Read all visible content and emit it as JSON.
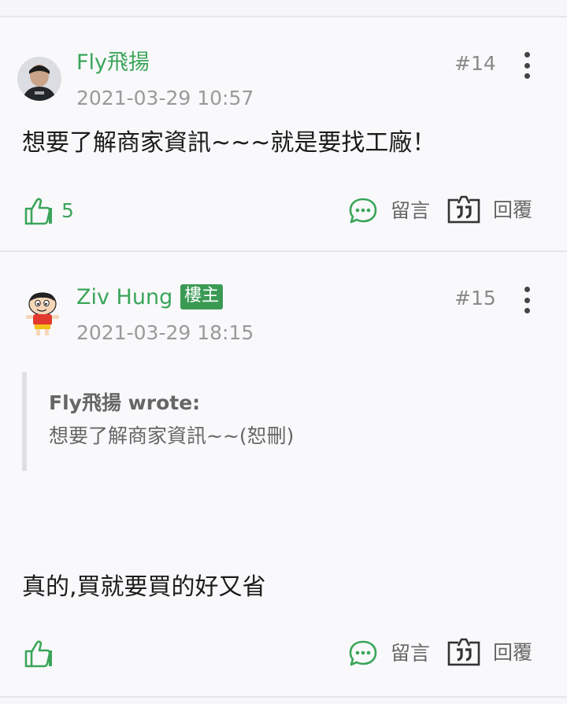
{
  "colors": {
    "accent": "#3aa55a",
    "badge": "#3a9a54",
    "muted": "#9a9a9a"
  },
  "posts": [
    {
      "author": "Fly飛揚",
      "floor": "#14",
      "time": "2021-03-29 10:57",
      "content": "想要了解商家資訊~~~就是要找工廠！",
      "like_count": "5",
      "comment_label": "留言",
      "reply_label": "回覆",
      "avatar_icon": "user-photo-avatar"
    },
    {
      "author": "Ziv Hung",
      "badge": "樓主",
      "floor": "#15",
      "time": "2021-03-29 18:15",
      "quote": {
        "author": "Fly飛揚 wrote:",
        "text": "想要了解商家資訊~~(恕刪)"
      },
      "content": "真的,買就要買的好又省",
      "comment_label": "留言",
      "reply_label": "回覆",
      "avatar_icon": "cartoon-character-avatar"
    }
  ]
}
